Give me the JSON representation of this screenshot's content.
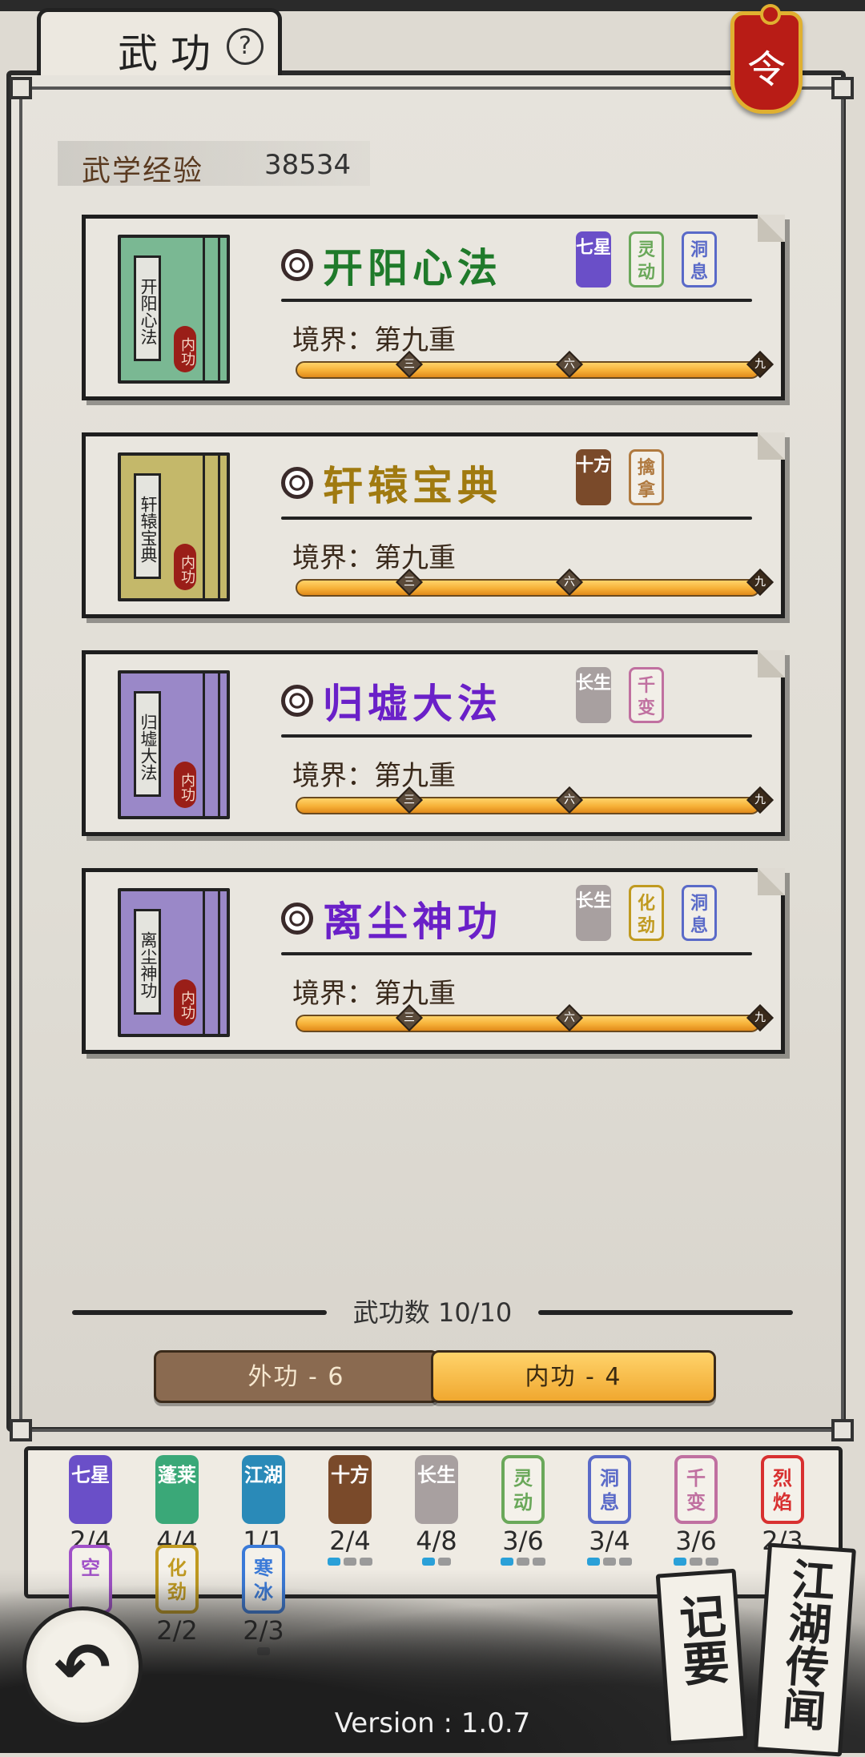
{
  "header": {
    "title": "武功",
    "help_icon": "?",
    "order_badge": "令"
  },
  "experience": {
    "label": "武学经验",
    "value": "38534"
  },
  "skills": [
    {
      "name": "开阳心法",
      "name_color": "#1f7a2a",
      "book_title": "开阳心法",
      "book_color": "#7ab893",
      "book_type": "内功",
      "realm": "境界：第九重",
      "traits": [
        {
          "text": "七星",
          "style": "solid",
          "color": "#6a4fc8"
        },
        {
          "text": "灵动",
          "style": "outline",
          "color": "#6aa85a"
        },
        {
          "text": "洞息",
          "style": "outline",
          "color": "#5a6ac8"
        }
      ],
      "progress_marks": [
        "三",
        "六",
        "九"
      ]
    },
    {
      "name": "轩辕宝典",
      "name_color": "#a07a10",
      "book_title": "轩辕宝典",
      "book_color": "#c4b86a",
      "book_type": "内功",
      "realm": "境界：第九重",
      "traits": [
        {
          "text": "十方",
          "style": "solid",
          "color": "#7a4a2a"
        },
        {
          "text": "擒拿",
          "style": "outline",
          "color": "#b07a40"
        }
      ],
      "progress_marks": [
        "三",
        "六",
        "九"
      ]
    },
    {
      "name": "归墟大法",
      "name_color": "#6a20c8",
      "book_title": "归墟大法",
      "book_color": "#9a88c8",
      "book_type": "内功",
      "realm": "境界：第九重",
      "traits": [
        {
          "text": "长生",
          "style": "solid",
          "color": "#a8a0a0"
        },
        {
          "text": "千变",
          "style": "outline",
          "color": "#c070a0"
        }
      ],
      "progress_marks": [
        "三",
        "六",
        "九"
      ]
    },
    {
      "name": "离尘神功",
      "name_color": "#6a20c8",
      "book_title": "离尘神功",
      "book_color": "#9a88c8",
      "book_type": "内功",
      "realm": "境界：第九重",
      "traits": [
        {
          "text": "长生",
          "style": "solid",
          "color": "#a8a0a0"
        },
        {
          "text": "化劲",
          "style": "outline",
          "color": "#c09a20"
        },
        {
          "text": "洞息",
          "style": "outline",
          "color": "#5a6ac8"
        }
      ],
      "progress_marks": [
        "三",
        "六",
        "九"
      ]
    }
  ],
  "skill_count": {
    "label": "武功数 10/10"
  },
  "tabs": {
    "outer": "外功 - 6",
    "inner": "内功 - 4",
    "active": "inner"
  },
  "passives": [
    {
      "text": "七星",
      "count": "2/4",
      "style": "solid",
      "color": "#6a4fc8",
      "filled": 0,
      "total": 0
    },
    {
      "text": "蓬莱",
      "count": "4/4",
      "style": "solid",
      "color": "#3aa878",
      "filled": 0,
      "total": 0
    },
    {
      "text": "江湖",
      "count": "1/1",
      "style": "solid",
      "color": "#2a8ab8",
      "filled": 0,
      "total": 0
    },
    {
      "text": "十方",
      "count": "2/4",
      "style": "solid",
      "color": "#7a4a2a",
      "filled": 1,
      "total": 3
    },
    {
      "text": "长生",
      "count": "4/8",
      "style": "solid",
      "color": "#a8a0a0",
      "filled": 1,
      "total": 2
    },
    {
      "text": "灵动",
      "count": "3/6",
      "style": "outline",
      "color": "#6aa85a",
      "filled": 1,
      "total": 3
    },
    {
      "text": "洞息",
      "count": "3/4",
      "style": "outline",
      "color": "#5a6ac8",
      "filled": 1,
      "total": 3
    },
    {
      "text": "千变",
      "count": "3/6",
      "style": "outline",
      "color": "#c070a0",
      "filled": 1,
      "total": 3
    },
    {
      "text": "烈焰",
      "count": "2/3",
      "style": "outline",
      "color": "#d83030",
      "filled": 1,
      "total": 1
    },
    {
      "text": "空",
      "count": "",
      "style": "outline",
      "color": "#a050c8",
      "filled": 0,
      "total": 0
    },
    {
      "text": "化劲",
      "count": "2/2",
      "style": "outline",
      "color": "#c09a20",
      "filled": 0,
      "total": 0
    },
    {
      "text": "寒冰",
      "count": "2/3",
      "style": "outline",
      "color": "#3a7ad8",
      "filled": 0,
      "total": 1
    }
  ],
  "footer": {
    "back_icon": "↶",
    "version": "Version : 1.0.7",
    "notes_label": "记要",
    "lore_label": "江湖传闻"
  }
}
